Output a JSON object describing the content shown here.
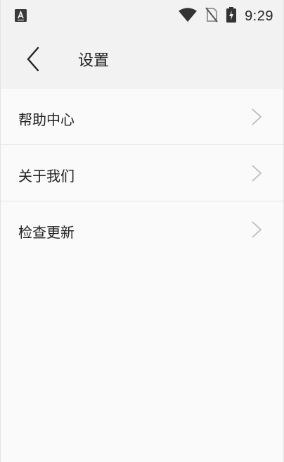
{
  "status_bar": {
    "time": "9:29",
    "left_icon": "app-notification-a-icon",
    "icons": [
      "wifi-icon",
      "no-sim-icon",
      "battery-charging-icon"
    ]
  },
  "header": {
    "title": "设置",
    "back_icon": "chevron-left-icon"
  },
  "menu": {
    "items": [
      {
        "label": "帮助中心",
        "icon": "chevron-right-icon"
      },
      {
        "label": "关于我们",
        "icon": "chevron-right-icon"
      },
      {
        "label": "检查更新",
        "icon": "chevron-right-icon"
      }
    ]
  },
  "colors": {
    "bar_background": "#f2f2f2",
    "page_background": "#fafafa",
    "divider": "#e6e6e6",
    "chevron": "#b8b8b8"
  }
}
